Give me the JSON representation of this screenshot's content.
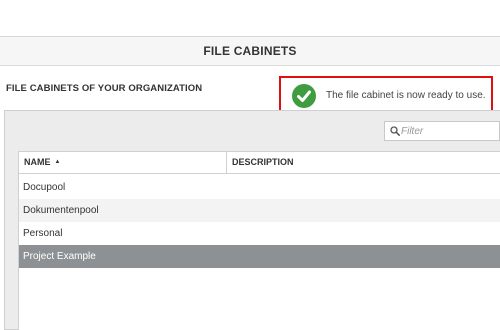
{
  "page": {
    "title": "FILE CABINETS"
  },
  "section": {
    "title": "FILE CABINETS OF YOUR ORGANIZATION"
  },
  "notification": {
    "message": "The file cabinet is now ready to use.",
    "icon": "check-circle-icon",
    "color": "#3f9c3f"
  },
  "filter": {
    "placeholder": "Filter",
    "value": "",
    "icon": "search-icon"
  },
  "table": {
    "columns": [
      {
        "label": "NAME",
        "sort": "ascending"
      },
      {
        "label": "DESCRIPTION"
      }
    ],
    "rows": [
      {
        "name": "Docupool",
        "description": ""
      },
      {
        "name": "Dokumentenpool",
        "description": ""
      },
      {
        "name": "Personal",
        "description": ""
      },
      {
        "name": "Project Example",
        "description": "",
        "selected": true
      }
    ]
  }
}
